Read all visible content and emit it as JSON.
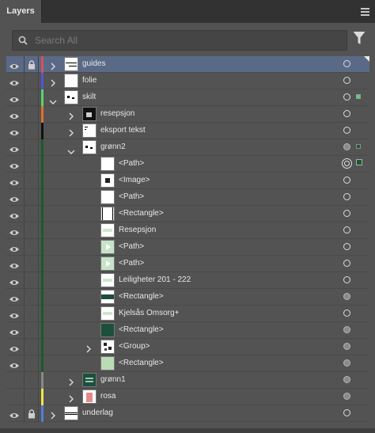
{
  "panel": {
    "tab_label": "Layers",
    "menu_icon": "hamburger-menu-icon"
  },
  "search": {
    "placeholder": "Search All",
    "value": ""
  },
  "colors": {
    "selected_row": "#5a6a86",
    "panel_bg": "#535353"
  },
  "rows": [
    {
      "name": "guides",
      "visible": true,
      "locked": true,
      "color": "#d9505a",
      "level": 0,
      "expand": "collapsed",
      "thumb": "guides",
      "selected": true,
      "target": "empty",
      "sel_square": "none"
    },
    {
      "name": "folie",
      "visible": true,
      "locked": false,
      "color": "#4e55d6",
      "level": 0,
      "expand": "collapsed",
      "thumb": "blank",
      "target": "empty",
      "sel_square": "none"
    },
    {
      "name": "skilt",
      "visible": true,
      "locked": false,
      "color": "#57d46a",
      "level": 0,
      "expand": "expanded",
      "thumb": "skilt",
      "target": "empty",
      "sel_square": "green"
    },
    {
      "name": "resepsjon",
      "visible": true,
      "locked": false,
      "color": "#e0702a",
      "level": 1,
      "expand": "collapsed",
      "thumb": "resepsjon",
      "target": "empty",
      "sel_square": "none"
    },
    {
      "name": "eksport tekst",
      "visible": true,
      "locked": false,
      "color": "#111111",
      "level": 1,
      "expand": "collapsed",
      "thumb": "eksport",
      "target": "empty",
      "sel_square": "none"
    },
    {
      "name": "grønn2",
      "visible": true,
      "locked": false,
      "color": "#1c5a2a",
      "level": 1,
      "expand": "expanded",
      "thumb": "gronn2",
      "target": "filled",
      "sel_square": "dark"
    },
    {
      "name": "<Path>",
      "visible": true,
      "locked": false,
      "color": "#1c5a2a",
      "level": 2,
      "expand": "none",
      "thumb": "blank",
      "target": "double",
      "sel_square": "dark-big"
    },
    {
      "name": "<Image>",
      "visible": true,
      "locked": false,
      "color": "#1c5a2a",
      "level": 2,
      "expand": "none",
      "thumb": "image",
      "target": "empty",
      "sel_square": "none"
    },
    {
      "name": "<Path>",
      "visible": true,
      "locked": false,
      "color": "#1c5a2a",
      "level": 2,
      "expand": "none",
      "thumb": "blank",
      "target": "empty",
      "sel_square": "none"
    },
    {
      "name": "<Rectangle>",
      "visible": true,
      "locked": false,
      "color": "#1c5a2a",
      "level": 2,
      "expand": "none",
      "thumb": "rect-outline",
      "target": "empty",
      "sel_square": "none"
    },
    {
      "name": "Resepsjon",
      "visible": true,
      "locked": false,
      "color": "#1c5a2a",
      "level": 2,
      "expand": "none",
      "thumb": "text-green",
      "target": "empty",
      "sel_square": "none"
    },
    {
      "name": "<Path>",
      "visible": true,
      "locked": false,
      "color": "#1c5a2a",
      "level": 2,
      "expand": "none",
      "thumb": "arrow-green",
      "target": "empty",
      "sel_square": "none"
    },
    {
      "name": "<Path>",
      "visible": true,
      "locked": false,
      "color": "#1c5a2a",
      "level": 2,
      "expand": "none",
      "thumb": "arrow-green",
      "target": "empty",
      "sel_square": "none"
    },
    {
      "name": "Leiligheter  201 - 222",
      "visible": true,
      "locked": false,
      "color": "#1c5a2a",
      "level": 2,
      "expand": "none",
      "thumb": "text-green",
      "target": "empty",
      "sel_square": "none"
    },
    {
      "name": "<Rectangle>",
      "visible": true,
      "locked": false,
      "color": "#1c5a2a",
      "level": 2,
      "expand": "none",
      "thumb": "band-dark",
      "target": "filled",
      "sel_square": "none"
    },
    {
      "name": "Kjelsås Omsorg+",
      "visible": true,
      "locked": false,
      "color": "#1c5a2a",
      "level": 2,
      "expand": "none",
      "thumb": "text-green",
      "target": "empty",
      "sel_square": "none"
    },
    {
      "name": "<Rectangle>",
      "visible": true,
      "locked": false,
      "color": "#1c5a2a",
      "level": 2,
      "expand": "none",
      "thumb": "rect-dark",
      "target": "filled",
      "sel_square": "none"
    },
    {
      "name": "<Group>",
      "visible": true,
      "locked": false,
      "color": "#1c5a2a",
      "level": 2,
      "expand": "collapsed",
      "thumb": "group",
      "target": "filled",
      "sel_square": "none"
    },
    {
      "name": "<Rectangle>",
      "visible": true,
      "locked": false,
      "color": "#1c5a2a",
      "level": 2,
      "expand": "none",
      "thumb": "rect-light",
      "target": "filled",
      "sel_square": "none"
    },
    {
      "name": "grønn1",
      "visible": false,
      "locked": false,
      "color": "#888888",
      "level": 1,
      "expand": "collapsed",
      "thumb": "gronn1",
      "target": "filled",
      "sel_square": "none"
    },
    {
      "name": "rosa",
      "visible": false,
      "locked": false,
      "color": "#f3e24a",
      "level": 1,
      "expand": "collapsed",
      "thumb": "rosa",
      "target": "filled",
      "sel_square": "none"
    },
    {
      "name": "underlag",
      "visible": true,
      "locked": true,
      "color": "#4f7fd8",
      "level": 0,
      "expand": "collapsed",
      "thumb": "underlag",
      "target": "empty",
      "sel_square": "none"
    }
  ]
}
